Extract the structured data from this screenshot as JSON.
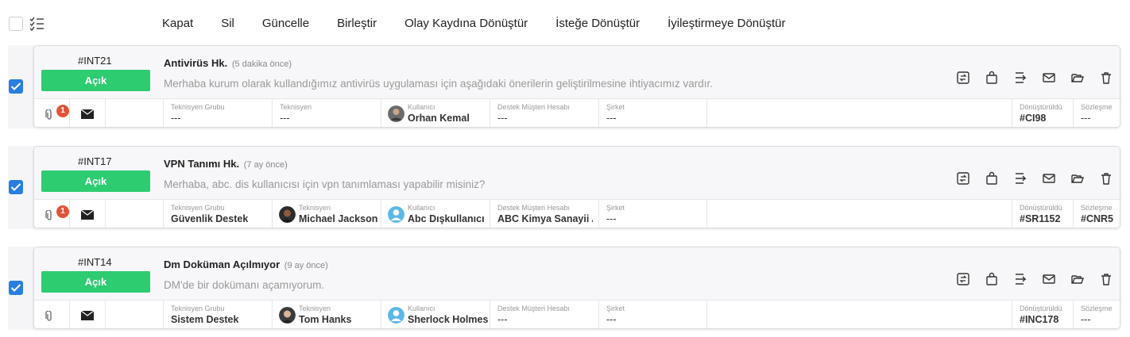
{
  "toolbar": {
    "actions": [
      "Kapat",
      "Sil",
      "Güncelle",
      "Birleştir",
      "Olay Kaydına Dönüştür",
      "İsteğe Dönüştür",
      "İyileştirmeye Dönüştür"
    ]
  },
  "labels": {
    "tech_group": "Teknisyen Grubu",
    "technician": "Teknisyen",
    "user": "Kullanıcı",
    "customer_account": "Destek Müşteri Hesabı",
    "company": "Şirket",
    "converted": "Dönüştürüldü",
    "contract": "Sözleşme"
  },
  "colors": {
    "status_open": "#2ecc71",
    "checkbox": "#2a7de1",
    "badge": "#e0553a"
  },
  "tickets": [
    {
      "id": "#INT21",
      "status": "Açık",
      "title": "Antivirüs Hk.",
      "time": "(5 dakika önce)",
      "description": "Merhaba kurum olarak kullandığımız antivirüs uygulaması için aşağıdaki önerilerin geliştirilmesine ihtiyacımız vardır.",
      "attachment_badge": "1",
      "tech_group": "---",
      "technician": "---",
      "user": "Orhan Kemal",
      "customer_account": "---",
      "company": "---",
      "converted": "#CI98",
      "contract": "---"
    },
    {
      "id": "#INT17",
      "status": "Açık",
      "title": "VPN Tanımı Hk.",
      "time": "(7 ay önce)",
      "description": "Merhaba, abc. dis kullanıcısı için vpn tanımlaması yapabilir misiniz?",
      "attachment_badge": "1",
      "tech_group": "Güvenlik Destek",
      "technician": "Michael Jackson",
      "user": "Abc Dışkullanıcı",
      "customer_account": "ABC Kimya Sanayii A.Ş.",
      "company": "---",
      "converted": "#SR1152",
      "contract": "#CNR5"
    },
    {
      "id": "#INT14",
      "status": "Açık",
      "title": "Dm Doküman Açılmıyor",
      "time": "(9 ay önce)",
      "description": "DM'de bir dokümanı açamıyorum.",
      "attachment_badge": "",
      "tech_group": "Sistem Destek",
      "technician": "Tom Hanks",
      "user": "Sherlock Holmes",
      "customer_account": "---",
      "company": "---",
      "converted": "#INC178",
      "contract": "---"
    }
  ]
}
